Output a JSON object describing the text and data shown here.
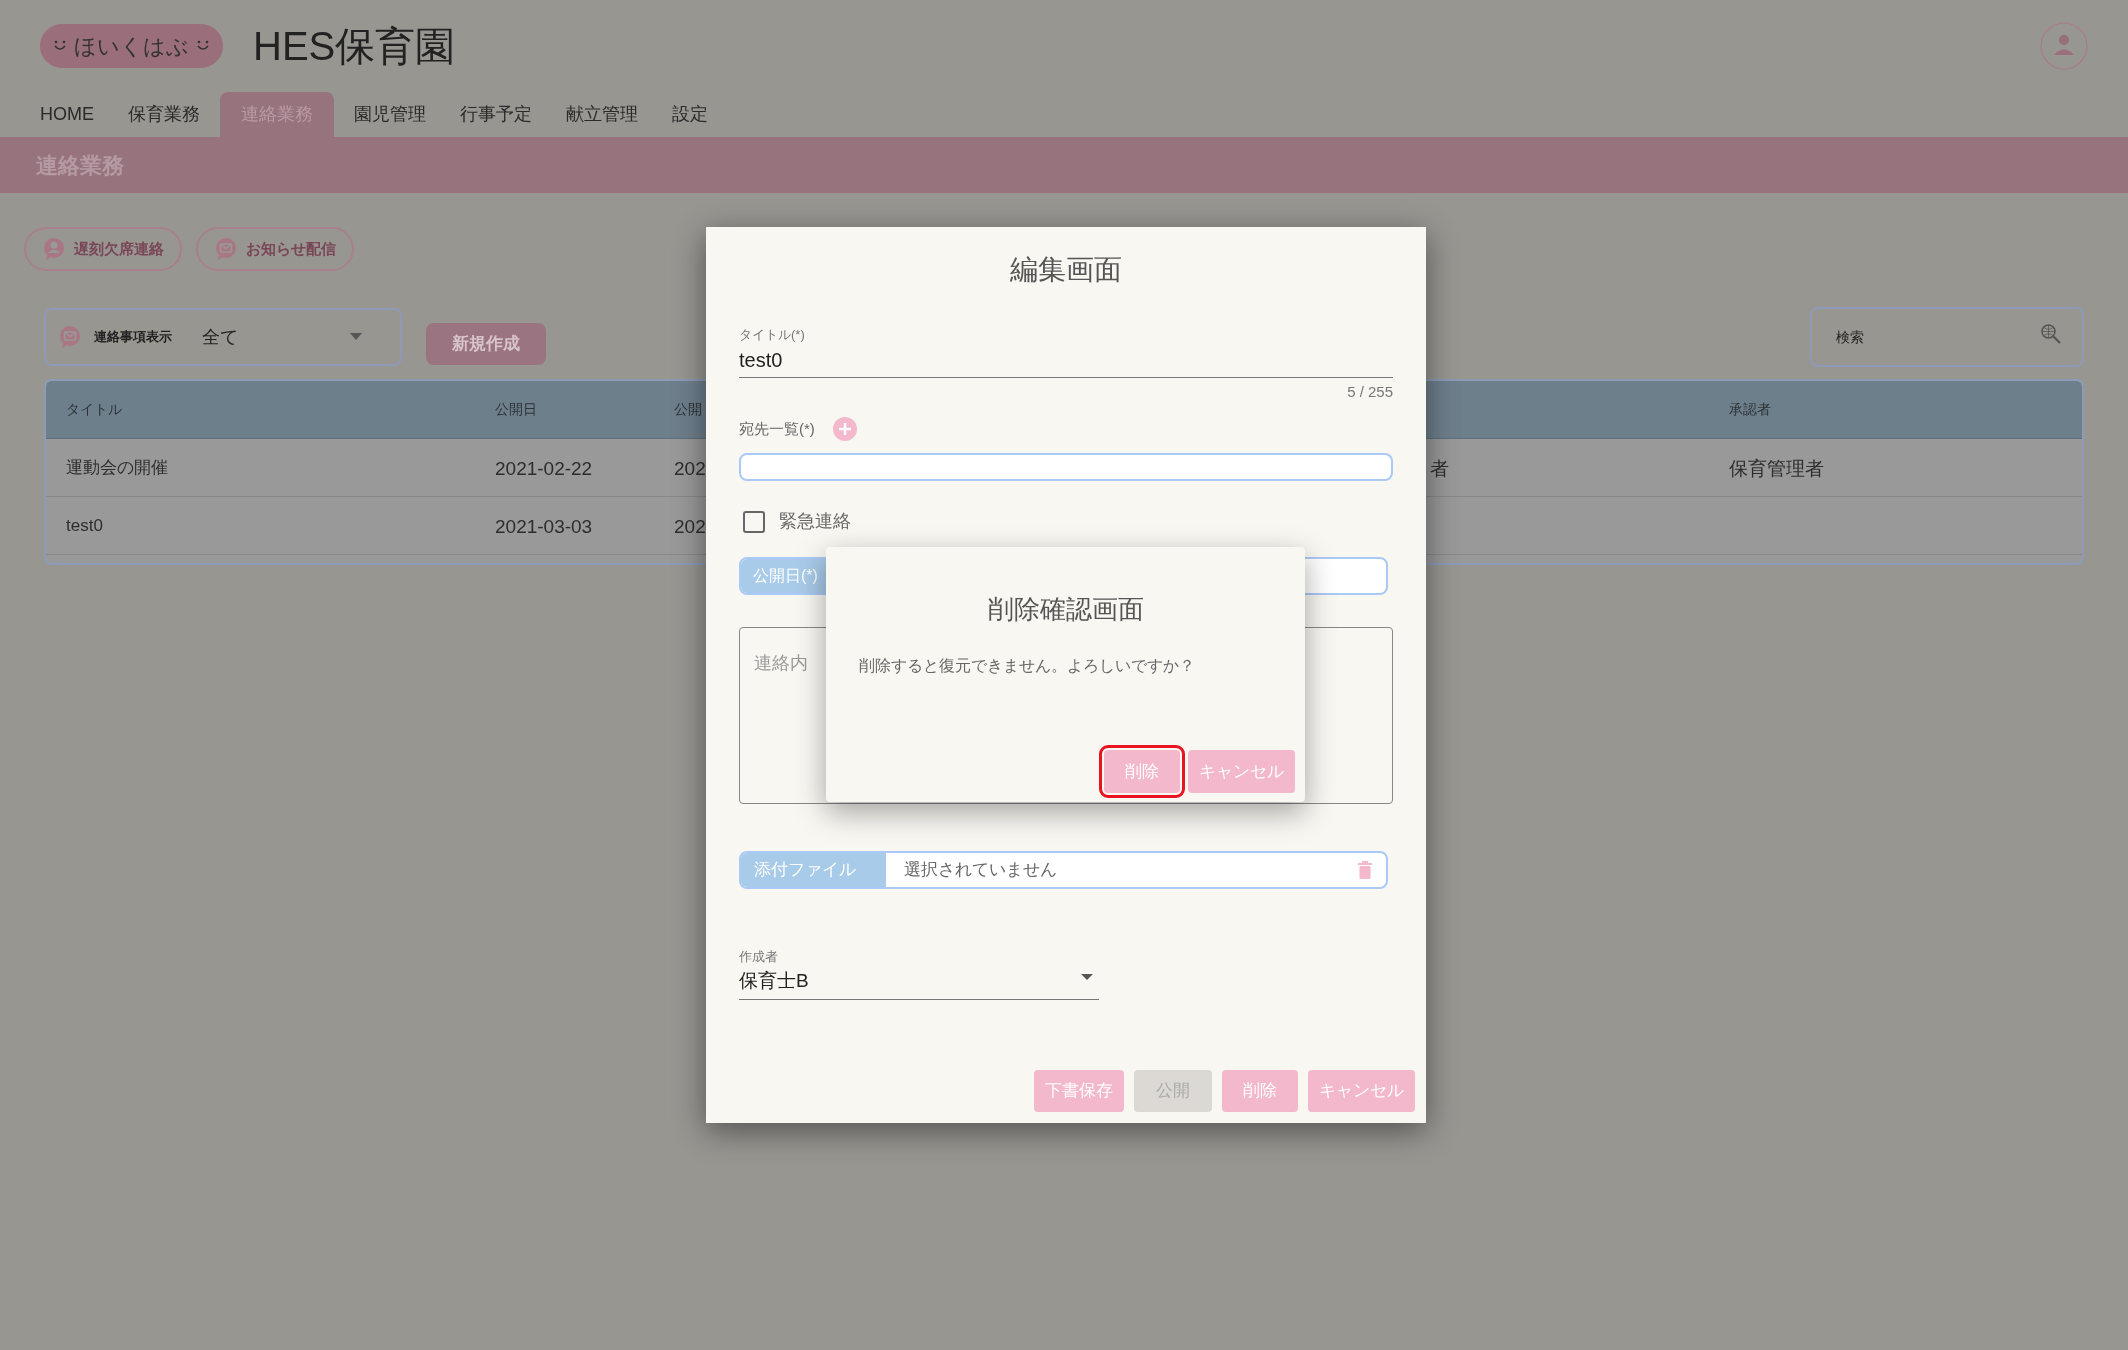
{
  "header": {
    "logo_text": "ほいくはぶ",
    "site_title": "HES保育園"
  },
  "nav": [
    {
      "label": "HOME",
      "selected": false
    },
    {
      "label": "保育業務",
      "selected": false
    },
    {
      "label": "連絡業務",
      "selected": true
    },
    {
      "label": "園児管理",
      "selected": false
    },
    {
      "label": "行事予定",
      "selected": false
    },
    {
      "label": "献立管理",
      "selected": false
    },
    {
      "label": "設定",
      "selected": false
    }
  ],
  "page_title": "連絡業務",
  "quick_buttons": [
    {
      "kind": "person",
      "label": "遅刻欠席連絡"
    },
    {
      "kind": "mail",
      "label": "お知らせ配信"
    }
  ],
  "filter": {
    "label": "連絡事項表示",
    "value": "全て"
  },
  "new_button": "新規作成",
  "search": {
    "placeholder": "検索"
  },
  "table": {
    "columns": [
      "タイトル",
      "公開日",
      "公開",
      "",
      "承認者"
    ],
    "rows": [
      [
        "運動会の開催",
        "2021-02-22",
        "202",
        "者",
        "保育管理者"
      ],
      [
        "test0",
        "2021-03-03",
        "202",
        "",
        ""
      ]
    ]
  },
  "edit_dialog": {
    "title": "編集画面",
    "title_field": {
      "label": "タイトル(*)",
      "value": "test0",
      "counter": "5 / 255"
    },
    "recipients": {
      "label": "宛先一覧(*)"
    },
    "urgent": {
      "label": "緊急連絡",
      "checked": false
    },
    "publish_date": {
      "label": "公開日(*)"
    },
    "content": {
      "placeholder": "連絡内"
    },
    "attachment": {
      "label": "添付ファイル",
      "value": "選択されていません"
    },
    "author": {
      "label": "作成者",
      "value": "保育士B"
    },
    "buttons": [
      {
        "label": "下書保存",
        "disabled": false
      },
      {
        "label": "公開",
        "disabled": true
      },
      {
        "label": "削除",
        "disabled": false
      },
      {
        "label": "キャンセル",
        "disabled": false
      }
    ]
  },
  "confirm_dialog": {
    "title": "削除確認画面",
    "message": "削除すると復元できません。よろしいですか？",
    "buttons": [
      {
        "label": "削除",
        "highlighted": true
      },
      {
        "label": "キャンセル",
        "highlighted": false
      }
    ]
  }
}
